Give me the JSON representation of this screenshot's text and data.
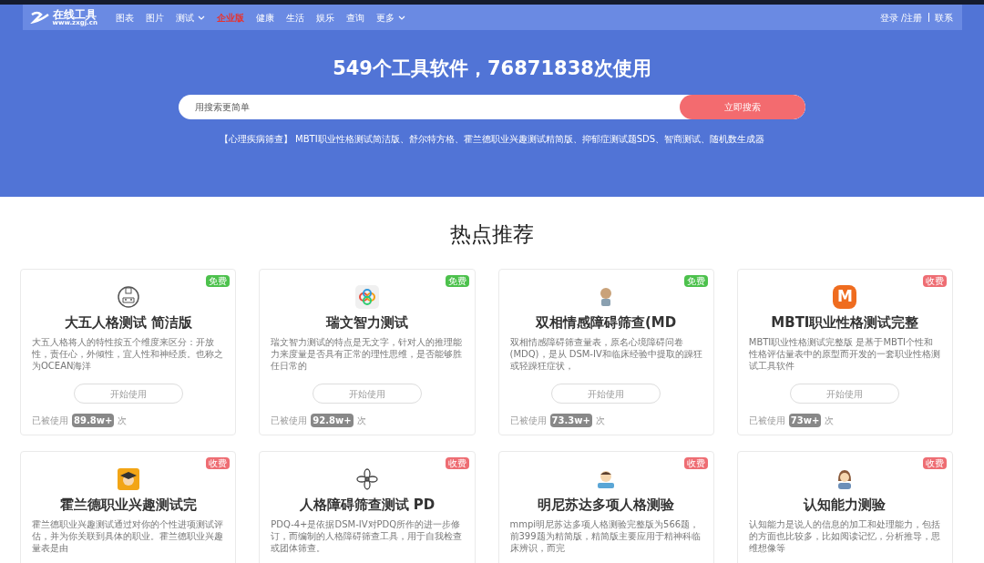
{
  "logo": {
    "name": "在线工具",
    "url": "www.zxgj.cn"
  },
  "nav": [
    {
      "label": "图表",
      "dropdown": false,
      "highlight": false
    },
    {
      "label": "图片",
      "dropdown": false,
      "highlight": false
    },
    {
      "label": "测试",
      "dropdown": true,
      "highlight": false
    },
    {
      "label": "企业版",
      "dropdown": false,
      "highlight": true
    },
    {
      "label": "健康",
      "dropdown": false,
      "highlight": false
    },
    {
      "label": "生活",
      "dropdown": false,
      "highlight": false
    },
    {
      "label": "娱乐",
      "dropdown": false,
      "highlight": false
    },
    {
      "label": "查询",
      "dropdown": false,
      "highlight": false
    },
    {
      "label": "更多",
      "dropdown": true,
      "highlight": false
    }
  ],
  "account": {
    "login": "登录 /注册",
    "contact": "联系"
  },
  "hero": {
    "title": "549个工具软件，76871838次使用",
    "search": {
      "placeholder": "用搜索更简单",
      "button": "立即搜索"
    },
    "tags": "【心理疾病筛查】  MBTI职业性格测试简洁版、舒尔特方格、霍兰德职业兴趣测试精简版、抑郁症测试题SDS、智商测试、随机数生成器"
  },
  "section_title": "热点推荐",
  "cards": [
    {
      "icon": {
        "kind": "robot"
      },
      "badge": {
        "text": "免费",
        "kind": "free"
      },
      "title": "大五人格测试 简洁版",
      "desc": "大五人格将人的特性按五个维度来区分：开放性，责任心，外倾性，宜人性和神经质。也称之为OCEAN海洋",
      "button": "开始使用",
      "usage": {
        "prefix": "已被使用",
        "count": "89.8w+",
        "suffix": "次"
      }
    },
    {
      "icon": {
        "kind": "knot"
      },
      "badge": {
        "text": "免费",
        "kind": "free"
      },
      "title": "瑞文智力测试",
      "desc": "瑞文智力测试的特点是无文字，针对人的推理能力来度量是否具有正常的理性思维，是否能够胜任日常的",
      "button": "开始使用",
      "usage": {
        "prefix": "已被使用",
        "count": "92.8w+",
        "suffix": "次"
      }
    },
    {
      "icon": {
        "kind": "figure"
      },
      "badge": {
        "text": "免费",
        "kind": "free"
      },
      "title": "双相情感障碍筛查(MD",
      "desc": "双相情感障碍筛查量表，原名心境障碍问卷(MDQ)，是从 DSM-IV和临床经验中提取的躁狂或轻躁狂症状，",
      "button": "开始使用",
      "usage": {
        "prefix": "已被使用",
        "count": "73.3w+",
        "suffix": "次"
      }
    },
    {
      "icon": {
        "kind": "letter",
        "letter": "M"
      },
      "badge": {
        "text": "收费",
        "kind": "paid"
      },
      "title": "MBTI职业性格测试完整",
      "desc": "MBTI职业性格测试完整版 是基于MBTI个性和性格评估量表中的原型而开发的一套职业性格测试工具软件",
      "button": "开始使用",
      "usage": {
        "prefix": "已被使用",
        "count": "73w+",
        "suffix": "次"
      }
    },
    {
      "icon": {
        "kind": "graduate"
      },
      "badge": {
        "text": "收费",
        "kind": "paid"
      },
      "title": "霍兰德职业兴趣测试完",
      "desc": "霍兰德职业兴趣测试通过对你的个性进项测试评估，并为你关联到具体的职业。霍兰德职业兴趣量表是由"
    },
    {
      "icon": {
        "kind": "flower"
      },
      "badge": {
        "text": "收费",
        "kind": "paid"
      },
      "title": "人格障碍筛查测试 PD",
      "desc": "PDQ-4+是依据DSM-IV对PDQ所作的进一步修订，而编制的人格障碍筛查工具，用于自我检查或团体筛查。"
    },
    {
      "icon": {
        "kind": "student"
      },
      "badge": {
        "text": "收费",
        "kind": "paid"
      },
      "title": "明尼苏达多项人格测验",
      "desc": "mmpi明尼苏达多项人格测验完整版为566题，前399题为精简版，精简版主要应用于精神科临床辨识，而完"
    },
    {
      "icon": {
        "kind": "woman"
      },
      "badge": {
        "text": "收费",
        "kind": "paid"
      },
      "title": "认知能力测验",
      "desc": "认知能力是说人的信息的加工和处理能力，包括的方面也比较多，比如阅读记忆，分析推导，思维想像等"
    }
  ]
}
